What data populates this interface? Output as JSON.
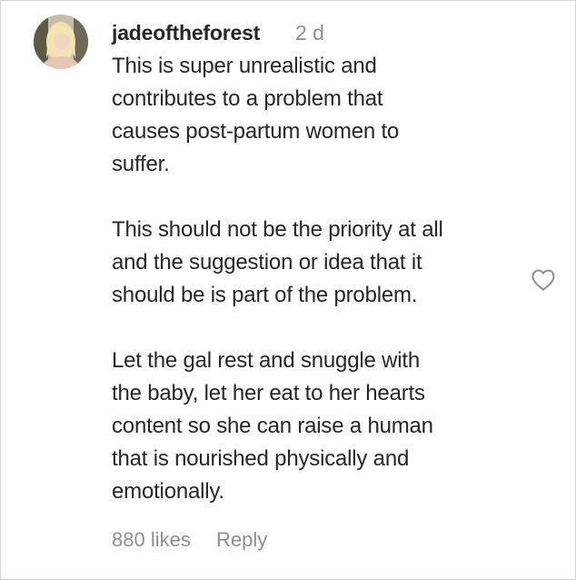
{
  "comment": {
    "username": "jadeoftheforest",
    "timestamp": "2 d",
    "paragraphs": [
      [
        "This is super unrealistic and",
        "contributes to a problem that",
        "causes post-partum women to",
        "suffer."
      ],
      [
        "This should not be the priority at all",
        "and the suggestion or idea that it",
        "should be is part of the problem."
      ],
      [
        "Let the gal rest and snuggle with",
        "the baby, let her eat to her hearts",
        "content so she can raise a human",
        "that is nourished physically and",
        "emotionally."
      ]
    ],
    "likes": "880 likes",
    "reply_label": "Reply",
    "like_icon": "heart-outline-icon",
    "avatar_icon": "profile-photo"
  }
}
